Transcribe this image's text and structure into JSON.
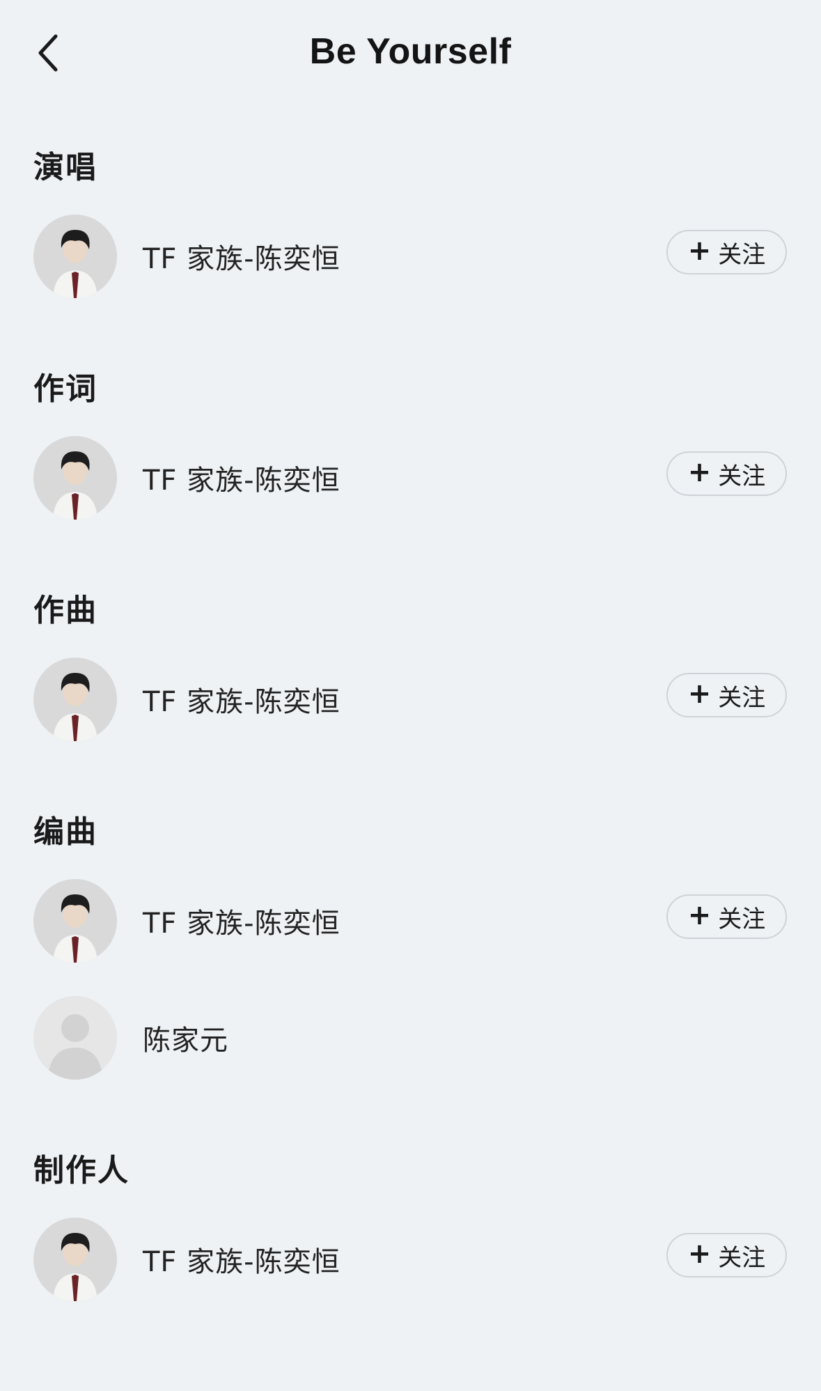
{
  "header": {
    "title": "Be Yourself",
    "back_icon": "chevron-left-icon"
  },
  "sections": [
    {
      "title": "演唱",
      "people": [
        {
          "name": "TF 家族-陈奕恒",
          "avatar": "photo",
          "follow_label": "关注",
          "follow_icon": "plus-icon"
        }
      ]
    },
    {
      "title": "作词",
      "people": [
        {
          "name": "TF 家族-陈奕恒",
          "avatar": "photo",
          "follow_label": "关注",
          "follow_icon": "plus-icon"
        }
      ]
    },
    {
      "title": "作曲",
      "people": [
        {
          "name": "TF 家族-陈奕恒",
          "avatar": "photo",
          "follow_label": "关注",
          "follow_icon": "plus-icon"
        }
      ]
    },
    {
      "title": "编曲",
      "people": [
        {
          "name": "TF 家族-陈奕恒",
          "avatar": "photo",
          "follow_label": "关注",
          "follow_icon": "plus-icon"
        },
        {
          "name": "陈家元",
          "avatar": "default-user-icon"
        }
      ]
    },
    {
      "title": "制作人",
      "people": [
        {
          "name": "TF 家族-陈奕恒",
          "avatar": "photo",
          "follow_label": "关注",
          "follow_icon": "plus-icon"
        }
      ]
    }
  ],
  "colors": {
    "background": "#eff2f5",
    "button_border": "#cfd2d6",
    "text": "#1a1a1a"
  }
}
